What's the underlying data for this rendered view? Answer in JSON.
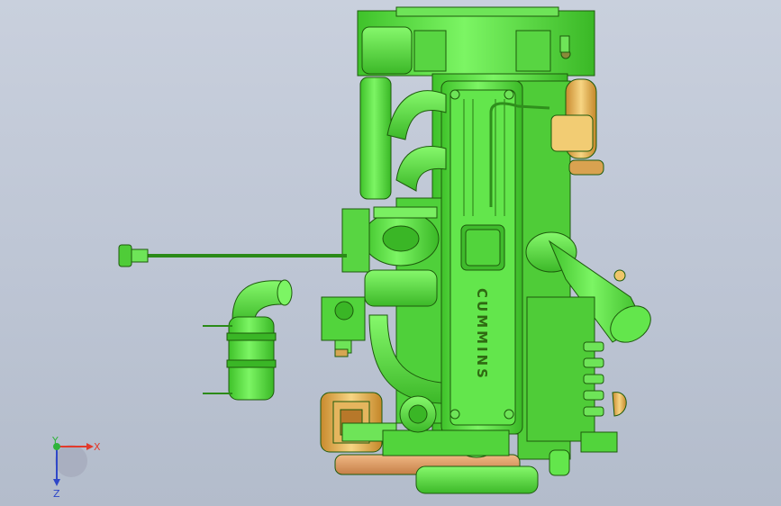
{
  "viewport": {
    "background_top": "#c9d0dd",
    "background_bottom": "#b3bccb"
  },
  "model": {
    "name": "engine-assembly",
    "primary_color": "#5fe84a",
    "outline_color": "#1d5a0c",
    "accent_color": "#ecbb5a",
    "logo_text": "CUMMINS"
  },
  "triad": {
    "x_label": "X",
    "y_label": "Y",
    "z_label": "Z",
    "x_color": "#e23a2c",
    "y_color": "#2fb33a",
    "z_color": "#2f47c8"
  }
}
